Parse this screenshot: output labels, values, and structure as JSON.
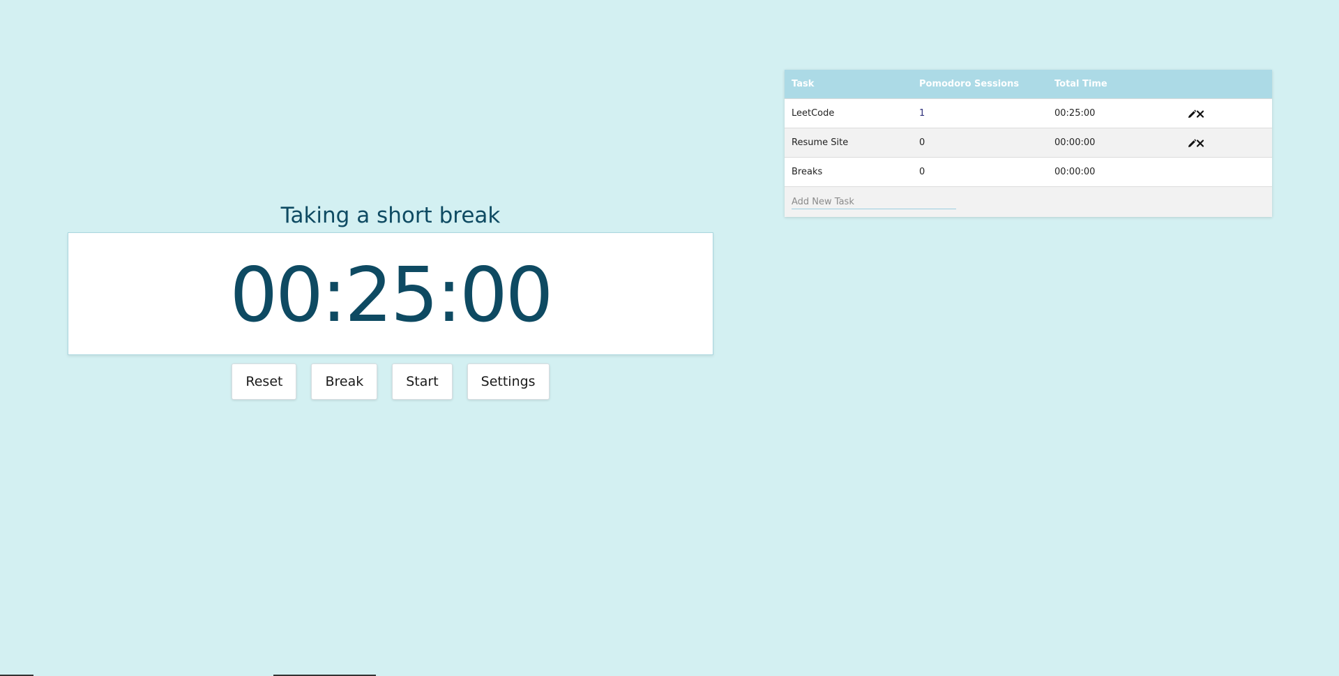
{
  "timer": {
    "status": "Taking a short break",
    "display": "00:25:00"
  },
  "buttons": {
    "reset": "Reset",
    "break": "Break",
    "start": "Start",
    "settings": "Settings"
  },
  "tasks": {
    "headers": {
      "task": "Task",
      "sessions": "Pomodoro Sessions",
      "total_time": "Total Time"
    },
    "rows": [
      {
        "task": "LeetCode",
        "sessions": "1",
        "total_time": "00:25:00",
        "editable": true
      },
      {
        "task": "Resume Site",
        "sessions": "0",
        "total_time": "00:00:00",
        "editable": true
      },
      {
        "task": "Breaks",
        "sessions": "0",
        "total_time": "00:00:00",
        "editable": false
      }
    ],
    "add_placeholder": "Add New Task"
  },
  "icons": {
    "edit": "pencil-icon",
    "delete": "close-icon"
  },
  "colors": {
    "background": "#d3f0f2",
    "accent": "#0e4a62",
    "table_header": "#acdae6"
  }
}
